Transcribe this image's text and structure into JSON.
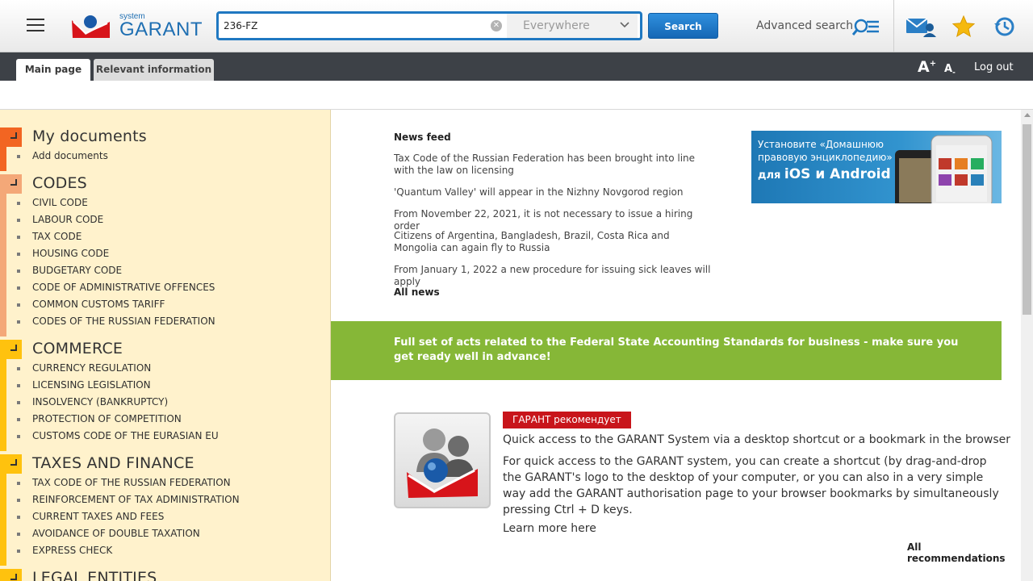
{
  "header": {
    "logo_small": "system",
    "logo_big": "GARANT",
    "search": {
      "value": "236-FZ",
      "placeholder": ""
    },
    "scope": {
      "selected": "Everywhere"
    },
    "search_button": "Search",
    "advanced_search": "Advanced search"
  },
  "tabs": {
    "main": "Main page",
    "relevant": "Relevant information",
    "font_increase": "A+",
    "font_decrease": "A-",
    "logout": "Log out"
  },
  "sidebar": {
    "sections": [
      {
        "title": "My documents",
        "color": "#f26522",
        "items": [
          "Add documents"
        ]
      },
      {
        "title": "CODES",
        "color": "#f4a878",
        "items": [
          "CIVIL CODE",
          "LABOUR CODE",
          "TAX CODE",
          "HOUSING CODE",
          "BUDGETARY CODE",
          "CODE OF ADMINISTRATIVE OFFENCES",
          "COMMON CUSTOMS TARIFF",
          "CODES OF THE RUSSIAN FEDERATION"
        ]
      },
      {
        "title": "COMMERCE",
        "color": "#ffc20e",
        "items": [
          "CURRENCY REGULATION",
          "LICENSING LEGISLATION",
          "INSOLVENCY (BANKRUPTCY)",
          "PROTECTION OF COMPETITION",
          "CUSTOMS CODE OF THE EURASIAN EU"
        ]
      },
      {
        "title": "TAXES AND FINANCE",
        "color": "#ffc20e",
        "items": [
          "TAX CODE OF THE RUSSIAN FEDERATION",
          "REINFORCEMENT OF TAX ADMINISTRATION",
          "CURRENT TAXES AND FEES",
          "AVOIDANCE OF DOUBLE TAXATION",
          "EXPRESS CHECK"
        ]
      },
      {
        "title": "LEGAL ENTITIES",
        "color": "#ffc20e",
        "items": []
      }
    ]
  },
  "news": {
    "title": "News feed",
    "items": [
      "Tax Code of the Russian Federation has been brought into line with the law on licensing",
      "'Quantum Valley' will appear in the Nizhny Novgorod region",
      "From November 22, 2021, it is not necessary to issue a hiring order",
      "Citizens of Argentina, Bangladesh, Brazil, Costa Rica and Mongolia can again fly to Russia",
      "From January 1, 2022 a new procedure for issuing sick leaves will apply"
    ],
    "all": "All news"
  },
  "promo_banner": {
    "line1": "Установите «Домашнюю правовую энциклопедию»",
    "line2_prefix": "для ",
    "line2_main": "iOS и Android"
  },
  "green_banner": {
    "text": "Full set of acts related to the Federal State Accounting Standards for business - make sure you get ready well in advance!",
    "color": "#86b737"
  },
  "recommendation": {
    "badge": "ГАРАНТ рекомендует",
    "heading": "Quick access to the GARANT System via a desktop shortcut or a bookmark in the browser",
    "body": "For quick access to the GARANT system, you can create a shortcut (by drag-and-drop the GARANT's logo to the desktop of your computer, or you can also in a very simple way add the GARANT authorisation page to your browser bookmarks by simultaneously pressing Ctrl + D keys.",
    "more": "Learn more here",
    "all": "All recommendations"
  },
  "colors": {
    "brand_blue": "#1f78c1",
    "brand_red": "#c8151b",
    "tabbar": "#3d4147",
    "sidebar_bg": "#fff2cc"
  }
}
